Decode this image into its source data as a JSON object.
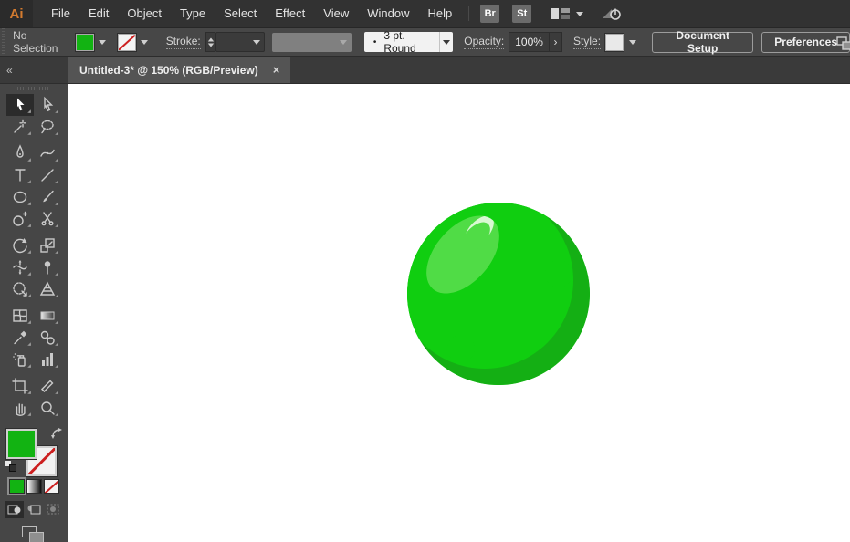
{
  "app": {
    "logo_text": "Ai"
  },
  "menu_bar": {
    "items": [
      "File",
      "Edit",
      "Object",
      "Type",
      "Select",
      "Effect",
      "View",
      "Window",
      "Help"
    ],
    "quick_buttons": [
      "Br",
      "St"
    ]
  },
  "control_bar": {
    "selection_status": "No Selection",
    "fill_color": "#12B312",
    "stroke_label": "Stroke:",
    "brush_bullet": "•",
    "brush_value": "3 pt. Round",
    "opacity_label": "Opacity:",
    "opacity_value": "100%",
    "next_glyph": "›",
    "style_label": "Style:",
    "document_setup_label": "Document Setup",
    "preferences_label": "Preferences"
  },
  "document_tab": {
    "title": "Untitled-3* @ 150% (RGB/Preview)",
    "close_glyph": "×"
  },
  "toolbar": {
    "collapse_glyph": "«",
    "active_tool": "selection",
    "fill_color": "#12B312",
    "groups": [
      [
        "selection",
        "direct-selection",
        "magic-wand",
        "lasso"
      ],
      [
        "pen",
        "curvature",
        "type",
        "line-segment",
        "ellipse",
        "paintbrush",
        "shape-builder",
        "scissors"
      ],
      [
        "rotate",
        "scale",
        "width",
        "puppet-warp",
        "free-transform",
        "perspective-grid"
      ],
      [
        "mesh",
        "gradient",
        "eyedropper",
        "blend",
        "symbol-sprayer",
        "column-graph"
      ],
      [
        "artboard",
        "slice",
        "hand",
        "zoom"
      ]
    ]
  },
  "canvas": {
    "artwork": {
      "description": "green ball with highlight",
      "ball_base": "#10CE10",
      "ball_shadow": "#14AF14",
      "ball_highlight": "#50DC46",
      "ball_shine": "#D9F9D3"
    }
  }
}
